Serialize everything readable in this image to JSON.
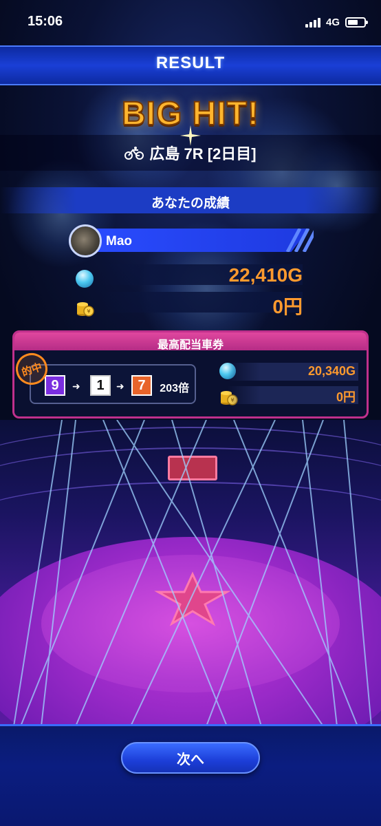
{
  "status_bar": {
    "time": "15:06",
    "network": "4G"
  },
  "header": {
    "title": "RESULT"
  },
  "hit": {
    "banner": "BIG HIT!",
    "race": "広島 7R [2日目]"
  },
  "score_section": {
    "title": "あなたの成績",
    "player_name": "Mao",
    "gold_value": "22,410G",
    "yen_value": "0円"
  },
  "ticket": {
    "title": "最高配当車券",
    "stamp": "的中",
    "numbers": [
      "9",
      "1",
      "7"
    ],
    "odds": "203倍",
    "gold_value": "20,340G",
    "yen_value": "0円"
  },
  "footer": {
    "next_label": "次へ"
  },
  "colors": {
    "accent_blue": "#1c3cc4",
    "value_orange": "#ff9a2e",
    "ticket_pink": "#c0308c",
    "banner_gold": "#ffb52e"
  },
  "icons": [
    "signal-icon",
    "battery-icon",
    "bicycle-icon",
    "orb-icon",
    "coin-icon",
    "sparkle-icon",
    "arrow-icon"
  ]
}
